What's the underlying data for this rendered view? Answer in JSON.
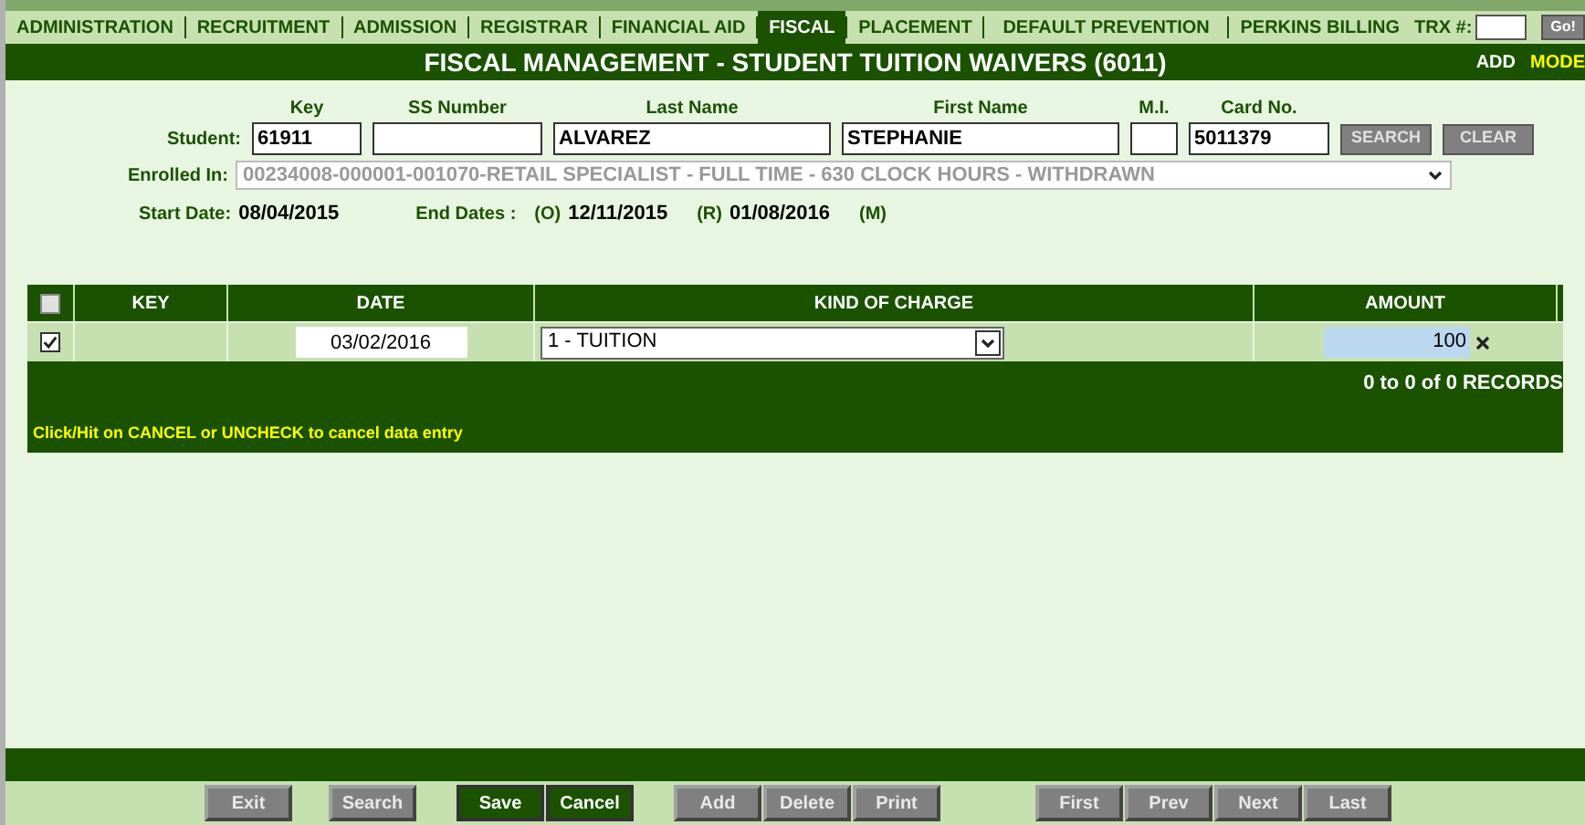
{
  "nav": {
    "tabs": [
      {
        "label": "ADMINISTRATION",
        "selected": false
      },
      {
        "label": "RECRUITMENT",
        "selected": false
      },
      {
        "label": "ADMISSION",
        "selected": false
      },
      {
        "label": "REGISTRAR",
        "selected": false
      },
      {
        "label": "FINANCIAL AID",
        "selected": false
      },
      {
        "label": "FISCAL",
        "selected": true
      },
      {
        "label": "PLACEMENT",
        "selected": false
      },
      {
        "label": "DEFAULT PREVENTION",
        "selected": false
      },
      {
        "label": "PERKINS BILLING",
        "selected": false
      }
    ],
    "trx_label": "TRX #:",
    "go_button": "Go!"
  },
  "title": "FISCAL MANAGEMENT - STUDENT TUITION WAIVERS (6011)",
  "modes": [
    "ADD",
    "MODE"
  ],
  "student": {
    "label": "Student:",
    "fields": [
      {
        "header": "Key",
        "value": "61911"
      },
      {
        "header": "SS Number"
      },
      {
        "header": "Last Name",
        "value": "ALVAREZ"
      },
      {
        "header": "First Name",
        "value": "STEPHANIE"
      },
      {
        "header": "M.I."
      },
      {
        "header": "Card No.",
        "value": "5011379"
      }
    ],
    "buttons": [
      "SEARCH",
      "CLEAR"
    ]
  },
  "enrolled": {
    "label": "Enrolled In:",
    "value": "00234008-000001-001070-RETAIL SPECIALIST - FULL TIME - 630 CLOCK HOURS - WITHDRAWN",
    "disabled": true
  },
  "dates": {
    "start_label": "Start Date:",
    "start": "08/04/2015",
    "end_label": "End Dates :",
    "o_label": "(O)",
    "o": "12/11/2015",
    "r_label": "(R)",
    "r": "01/08/2016",
    "m_label": "(M)"
  },
  "table": {
    "header_checked": false,
    "columns": [
      "KEY",
      "DATE",
      "KIND OF CHARGE",
      "AMOUNT"
    ],
    "rows": [
      {
        "checked": true,
        "date": "03/02/2016",
        "kind": "1 - TUITION",
        "amount": "100"
      }
    ],
    "records": "0 to 0 of 0 RECORDS",
    "hint": "Click/Hit on CANCEL or UNCHECK to cancel data entry"
  },
  "button_groups": [
    [
      {
        "label": "Exit",
        "disabled": true
      }
    ],
    [
      {
        "label": "Search",
        "disabled": true
      }
    ],
    [
      {
        "label": "Save",
        "disabled": false
      },
      {
        "label": "Cancel",
        "disabled": false
      }
    ],
    [
      {
        "label": "Add",
        "disabled": true
      },
      {
        "label": "Delete",
        "disabled": true
      },
      {
        "label": "Print",
        "disabled": true
      }
    ],
    [
      {
        "label": "First",
        "disabled": true
      },
      {
        "label": "Prev",
        "disabled": true
      },
      {
        "label": "Next",
        "disabled": true
      },
      {
        "label": "Last",
        "disabled": true
      }
    ]
  ]
}
